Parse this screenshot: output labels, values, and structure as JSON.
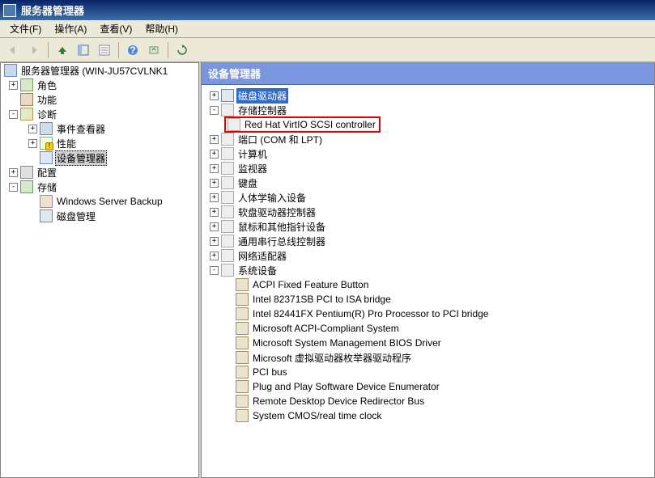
{
  "window": {
    "title": "服务器管理器"
  },
  "menubar": {
    "file": "文件(F)",
    "action": "操作(A)",
    "view": "查看(V)",
    "help": "帮助(H)"
  },
  "left_tree": {
    "root": "服务器管理器 (WIN-JU57CVLNK1",
    "roles": "角色",
    "features": "功能",
    "diagnostics": "诊断",
    "event_viewer": "事件查看器",
    "performance": "性能",
    "device_manager": "设备管理器",
    "configuration": "配置",
    "storage": "存储",
    "wsb": "Windows Server Backup",
    "disk_mgmt": "磁盘管理"
  },
  "right_panel": {
    "title": "设备管理器",
    "categories": {
      "disk_drives": "磁盘驱动器",
      "storage_controllers": "存储控制器",
      "redhat_virtio": "Red Hat VirtIO SCSI controller",
      "ports": "端口 (COM 和 LPT)",
      "computer": "计算机",
      "monitor": "监视器",
      "keyboard": "键盘",
      "hid": "人体学输入设备",
      "floppy_ctrl": "软盘驱动器控制器",
      "mouse": "鼠标和其他指针设备",
      "usb": "通用串行总线控制器",
      "network": "网络适配器",
      "system_devices": "系统设备"
    },
    "system_children": [
      "ACPI Fixed Feature Button",
      "Intel 82371SB PCI to ISA bridge",
      "Intel 82441FX Pentium(R) Pro Processor to PCI bridge",
      "Microsoft ACPI-Compliant System",
      "Microsoft System Management BIOS Driver",
      "Microsoft 虚拟驱动器枚举器驱动程序",
      "PCI bus",
      "Plug and Play Software Device Enumerator",
      "Remote Desktop Device Redirector Bus",
      "System CMOS/real time clock"
    ]
  }
}
